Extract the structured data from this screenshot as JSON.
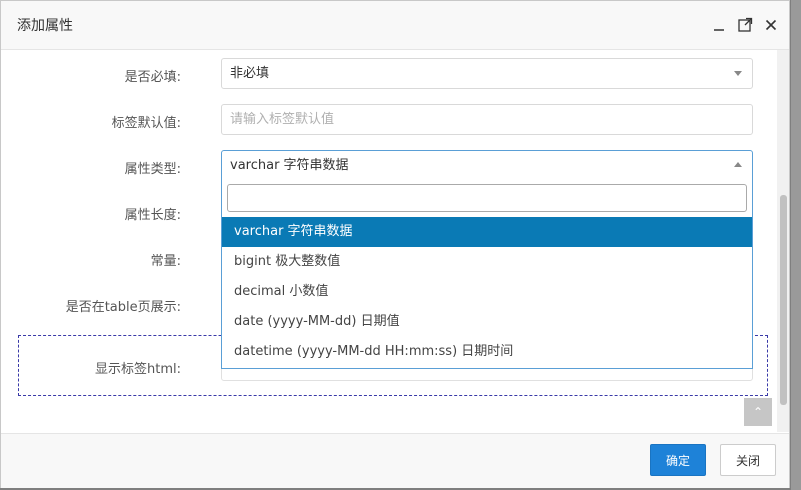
{
  "dialog": {
    "title": "添加属性",
    "icons": [
      "minimize-icon",
      "maximize-icon",
      "close-icon"
    ]
  },
  "form": {
    "required": {
      "label": "是否必填:",
      "value": "非必填"
    },
    "default_value": {
      "label": "标签默认值:",
      "placeholder": "请输入标签默认值"
    },
    "attr_type": {
      "label": "属性类型:",
      "value": "varchar 字符串数据"
    },
    "attr_length": {
      "label": "属性长度:"
    },
    "constant": {
      "label": "常量:"
    },
    "show_in_table": {
      "label": "是否在table页展示:"
    },
    "display_html": {
      "label": "显示标签html:"
    }
  },
  "dropdown": {
    "search_value": "",
    "options": [
      "varchar 字符串数据",
      "bigint 极大整数值",
      "decimal 小数值",
      "date (yyyy-MM-dd) 日期值",
      "datetime (yyyy-MM-dd HH:mm:ss) 日期时间"
    ],
    "selected_index": 0
  },
  "footer": {
    "confirm_label": "确定",
    "close_label": "关闭"
  }
}
